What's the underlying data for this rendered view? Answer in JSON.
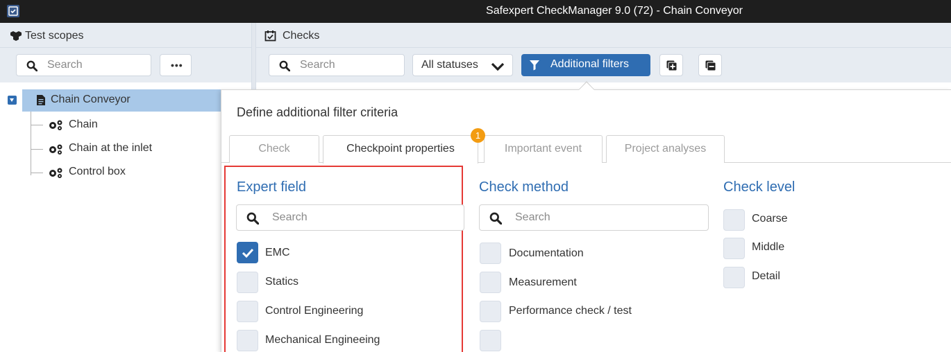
{
  "titlebar": {
    "title": "Safexpert CheckManager 9.0 (72) - Chain Conveyor"
  },
  "left_panel": {
    "header": "Test scopes",
    "search_placeholder": "Search",
    "more_button": "•••",
    "tree": {
      "root": "Chain Conveyor",
      "children": [
        "Chain",
        "Chain at the inlet",
        "Control box"
      ]
    }
  },
  "right_panel": {
    "header": "Checks",
    "search_placeholder": "Search",
    "status_dropdown": "All statuses",
    "filter_button": "Additional filters"
  },
  "popover": {
    "title": "Define additional filter criteria",
    "tabs": [
      {
        "label": "Check",
        "active": false
      },
      {
        "label": "Checkpoint properties",
        "active": true,
        "badge": "1"
      },
      {
        "label": "Important event",
        "active": false
      },
      {
        "label": "Project analyses",
        "active": false
      }
    ],
    "columns": {
      "expert_field": {
        "title": "Expert field",
        "search_placeholder": "Search",
        "options": [
          {
            "label": "EMC",
            "checked": true
          },
          {
            "label": "Statics",
            "checked": false
          },
          {
            "label": "Control Engineering",
            "checked": false
          },
          {
            "label": "Mechanical Engineeing",
            "checked": false
          }
        ]
      },
      "check_method": {
        "title": "Check method",
        "search_placeholder": "Search",
        "options": [
          {
            "label": "Documentation",
            "checked": false
          },
          {
            "label": "Measurement",
            "checked": false
          },
          {
            "label": "Performance check / test",
            "checked": false
          },
          {
            "label": "",
            "checked": false
          }
        ]
      },
      "check_level": {
        "title": "Check level",
        "options": [
          {
            "label": "Coarse",
            "checked": false
          },
          {
            "label": "Middle",
            "checked": false
          },
          {
            "label": "Detail",
            "checked": false
          }
        ]
      }
    }
  },
  "colors": {
    "accent": "#2f6db2",
    "badge": "#f39c12",
    "highlight": "#e53935",
    "panel_bg": "#e7ecf2",
    "tree_selected": "#a8c8e8"
  }
}
